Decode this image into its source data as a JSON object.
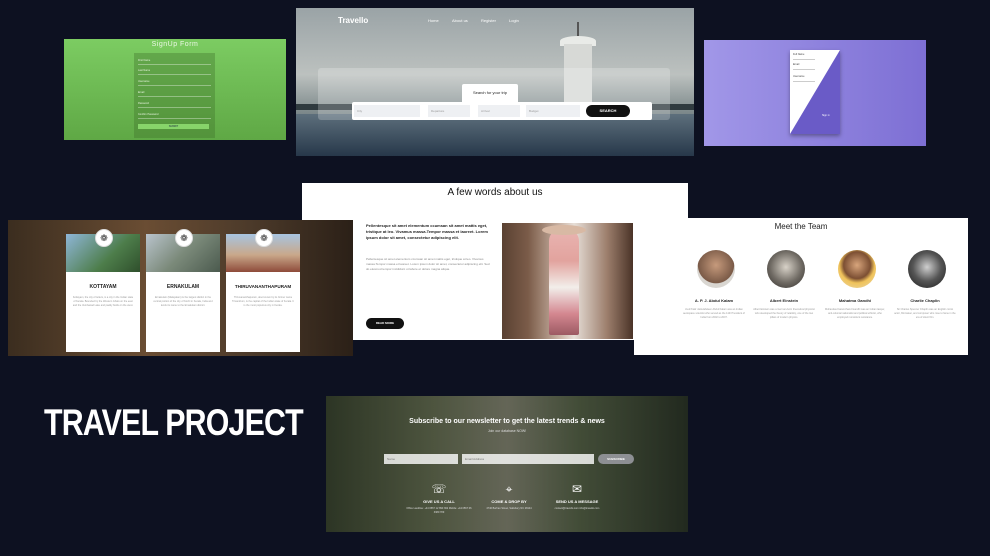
{
  "title": "TRAVEL PROJECT",
  "signup": {
    "heading": "SignUp Form",
    "fields": [
      "First Name",
      "Last Name",
      "Username",
      "Email",
      "Password",
      "Confirm Password"
    ],
    "button": "SUBMIT"
  },
  "hero": {
    "logo": "Travello",
    "nav": [
      "Home",
      "About us",
      "Register",
      "Login"
    ],
    "search_title": "Search for your trip",
    "fields": [
      "City",
      "Departure",
      "Arrival",
      "Budget"
    ],
    "search_button": "SEARCH"
  },
  "purple": {
    "lines": [
      "Full Name",
      "Email",
      "Username",
      "Sign in"
    ],
    "colors": {
      "bg_left": "#a197e8",
      "bg_right": "#7d6fd4",
      "accent": "#6a5bc7"
    }
  },
  "about": {
    "heading": "A few words about us",
    "bold": "Pellentesque sit amet elementum ccumsan sit amet mattis eget, tristique at leo. Vivamus massa.Tempor massa et laoreet. Lorem ipsum dolor sit amet, consectetur adipiscing elit.",
    "paragraph": "Pellentesque sit amet elementum ccumsan sit amet mattis eget, tristique at leo. Vivamus massa.Tempor massa et laoreet. Lorem ipsum dolor sit amet, consectetur adipiscing elit. Sed do eiusmod tempor incididunt ut labore et dolore magna aliqua.",
    "button": "READ MORE"
  },
  "kerala": {
    "cards": [
      {
        "name": "KOTTAYAM",
        "desc": "Kottayam, the city of letters, is a city in the Indian state of Kerala. Bounded by the Western Ghats on the east and the Vembanad Lake and paddy fields on the west."
      },
      {
        "name": "ERNAKULAM",
        "desc": "Ernakulam (Malayalam) is the largest district in the central portion of the city of Kochi in Kerala, India and lends its name to the Ernakulam district."
      },
      {
        "name": "THIRUVANANTHAPURAM",
        "desc": "Thiruvananthapuram, also known by its former name Trivandrum, is the capital of the Indian state of Kerala. It is the most populous city in Kerala."
      }
    ]
  },
  "team": {
    "heading": "Meet the Team",
    "members": [
      {
        "name": "A. P. J. Abdul Kalam",
        "desc": "Avul Pakir Jainulabdeen Abdul Kalam was an Indian aerospace scientist who served as the 11th President of India from 2002 to 2007."
      },
      {
        "name": "Albert Einstein",
        "desc": "Albert Einstein was a German-born theoretical physicist who developed the theory of relativity, one of the two pillars of modern physics."
      },
      {
        "name": "Mahatma Gandhi",
        "desc": "Mohandas Karamchand Gandhi was an Indian lawyer, anti-colonial nationalist and political ethicist, who employed nonviolent resistance."
      },
      {
        "name": "Charlie Chaplin",
        "desc": "Sir Charles Spencer Chaplin was an English comic actor, filmmaker, and composer who rose to fame in the era of silent film."
      }
    ]
  },
  "newsletter": {
    "heading": "Subscribe to our newsletter to get the latest trends & news",
    "sub": "Join our database NOW!",
    "inputs": [
      "Name",
      "Email Address"
    ],
    "button": "SUBSCRIBE",
    "contacts": [
      {
        "label": "GIVE US A CALL",
        "icon": "phone-icon",
        "text": "Office Landline: +44 0567 12 890 362 Mobile: +44 0567 06 3389 789"
      },
      {
        "label": "COME & DROP BY",
        "icon": "location-icon",
        "text": "4746 Burhan Street, Salisbury NC 28144"
      },
      {
        "label": "SEND US A MESSAGE",
        "icon": "mail-icon",
        "text": "contact@travello.com info@travello.com"
      }
    ]
  }
}
